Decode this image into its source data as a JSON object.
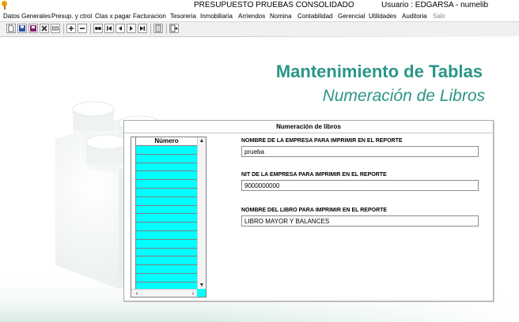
{
  "window": {
    "title": "PRESUPUESTO PRUEBAS CONSOLIDADO",
    "user_text": "Usuario : EDGARSA - numelib"
  },
  "menu": [
    {
      "label": "Datos Generales",
      "enabled": true
    },
    {
      "label": "Presup. y ctrol",
      "enabled": true
    },
    {
      "label": "Ctas x pagar",
      "enabled": true
    },
    {
      "label": "Facturacion",
      "enabled": true
    },
    {
      "label": "Tesoreria",
      "enabled": true
    },
    {
      "label": "Inmobiliaria",
      "enabled": true
    },
    {
      "label": "Arriendos",
      "enabled": true
    },
    {
      "label": "Nomina",
      "enabled": true
    },
    {
      "label": "Contabilidad",
      "enabled": true
    },
    {
      "label": "Gerencial",
      "enabled": true
    },
    {
      "label": "Utilidades",
      "enabled": true
    },
    {
      "label": "Auditoria",
      "enabled": true
    },
    {
      "label": "Salir",
      "enabled": false
    }
  ],
  "toolbar": {
    "icons": [
      "new-icon",
      "save-icon",
      "print-icon",
      "delete-icon",
      "undo-icon",
      "add-icon",
      "remove-icon",
      "search-icon",
      "first-record-icon",
      "previous-record-icon",
      "next-record-icon",
      "last-record-icon",
      "report-icon",
      "exit-icon"
    ]
  },
  "heading": {
    "title": "Mantenimiento de Tablas",
    "subtitle": "Numeración de Libros"
  },
  "panel": {
    "title": "Numeración de libros",
    "grid": {
      "column_header": "Número",
      "rows": [
        "",
        "",
        "",
        "",
        "",
        "",
        "",
        "",
        "",
        "",
        "",
        "",
        "",
        "",
        "",
        "",
        ""
      ]
    },
    "fields": [
      {
        "label": "NOMBRE DE LA EMPRESA PARA IMPRIMIR EN EL REPORTE",
        "value": "prueba"
      },
      {
        "label": "NIT DE LA EMPRESA PARA IMPRIMIR EN EL REPORTE",
        "value": "9000000000"
      },
      {
        "label": "NOMBRE DEL LIBRO PARA IMPRIMIR EN EL REPORTE",
        "value": "LIBRO MAYOR Y BALANCES"
      }
    ]
  },
  "colors": {
    "accent": "#2a9687",
    "grid_fill": "#00ffff"
  }
}
